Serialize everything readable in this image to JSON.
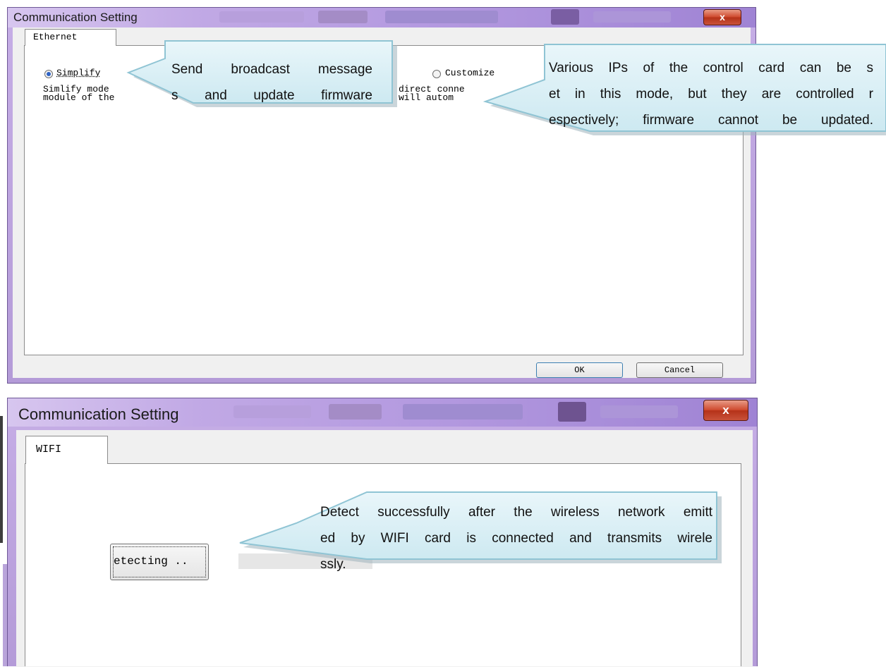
{
  "dialog_ethernet": {
    "title": "Communication Setting",
    "close_label": "x",
    "tab_label": "Ethernet",
    "simplify_radio": {
      "label": "Simplify",
      "checked": true
    },
    "customize_radio": {
      "label": "Customize",
      "checked": false
    },
    "simplify_desc_line1": "Simlify mode",
    "simplify_desc_line2": "module of the",
    "customize_desc_line1": "direct conne",
    "customize_desc_line2": "will autom",
    "ok_label": "OK",
    "cancel_label": "Cancel"
  },
  "dialog_wifi": {
    "title": "Communication Setting",
    "close_label": "x",
    "tab_label": "WIFI",
    "detect_button_label": "etecting .."
  },
  "callouts": {
    "simplify_note": [
      "Send broadcast message",
      "s and update firmware"
    ],
    "customize_note": [
      "Various IPs of the control card can be s",
      "et in this mode, but they are controlled r",
      "espectively; firmware cannot be updated."
    ],
    "wifi_note": [
      "Detect successfully after the wireless network emitt",
      "ed by WIFI card is connected and transmits wirele",
      "ssly."
    ]
  },
  "colors": {
    "window_frame": "#b49bd8",
    "close_button": "#c9452d",
    "callout_fill": "#d6eef5",
    "callout_border": "#8fc4d4"
  }
}
